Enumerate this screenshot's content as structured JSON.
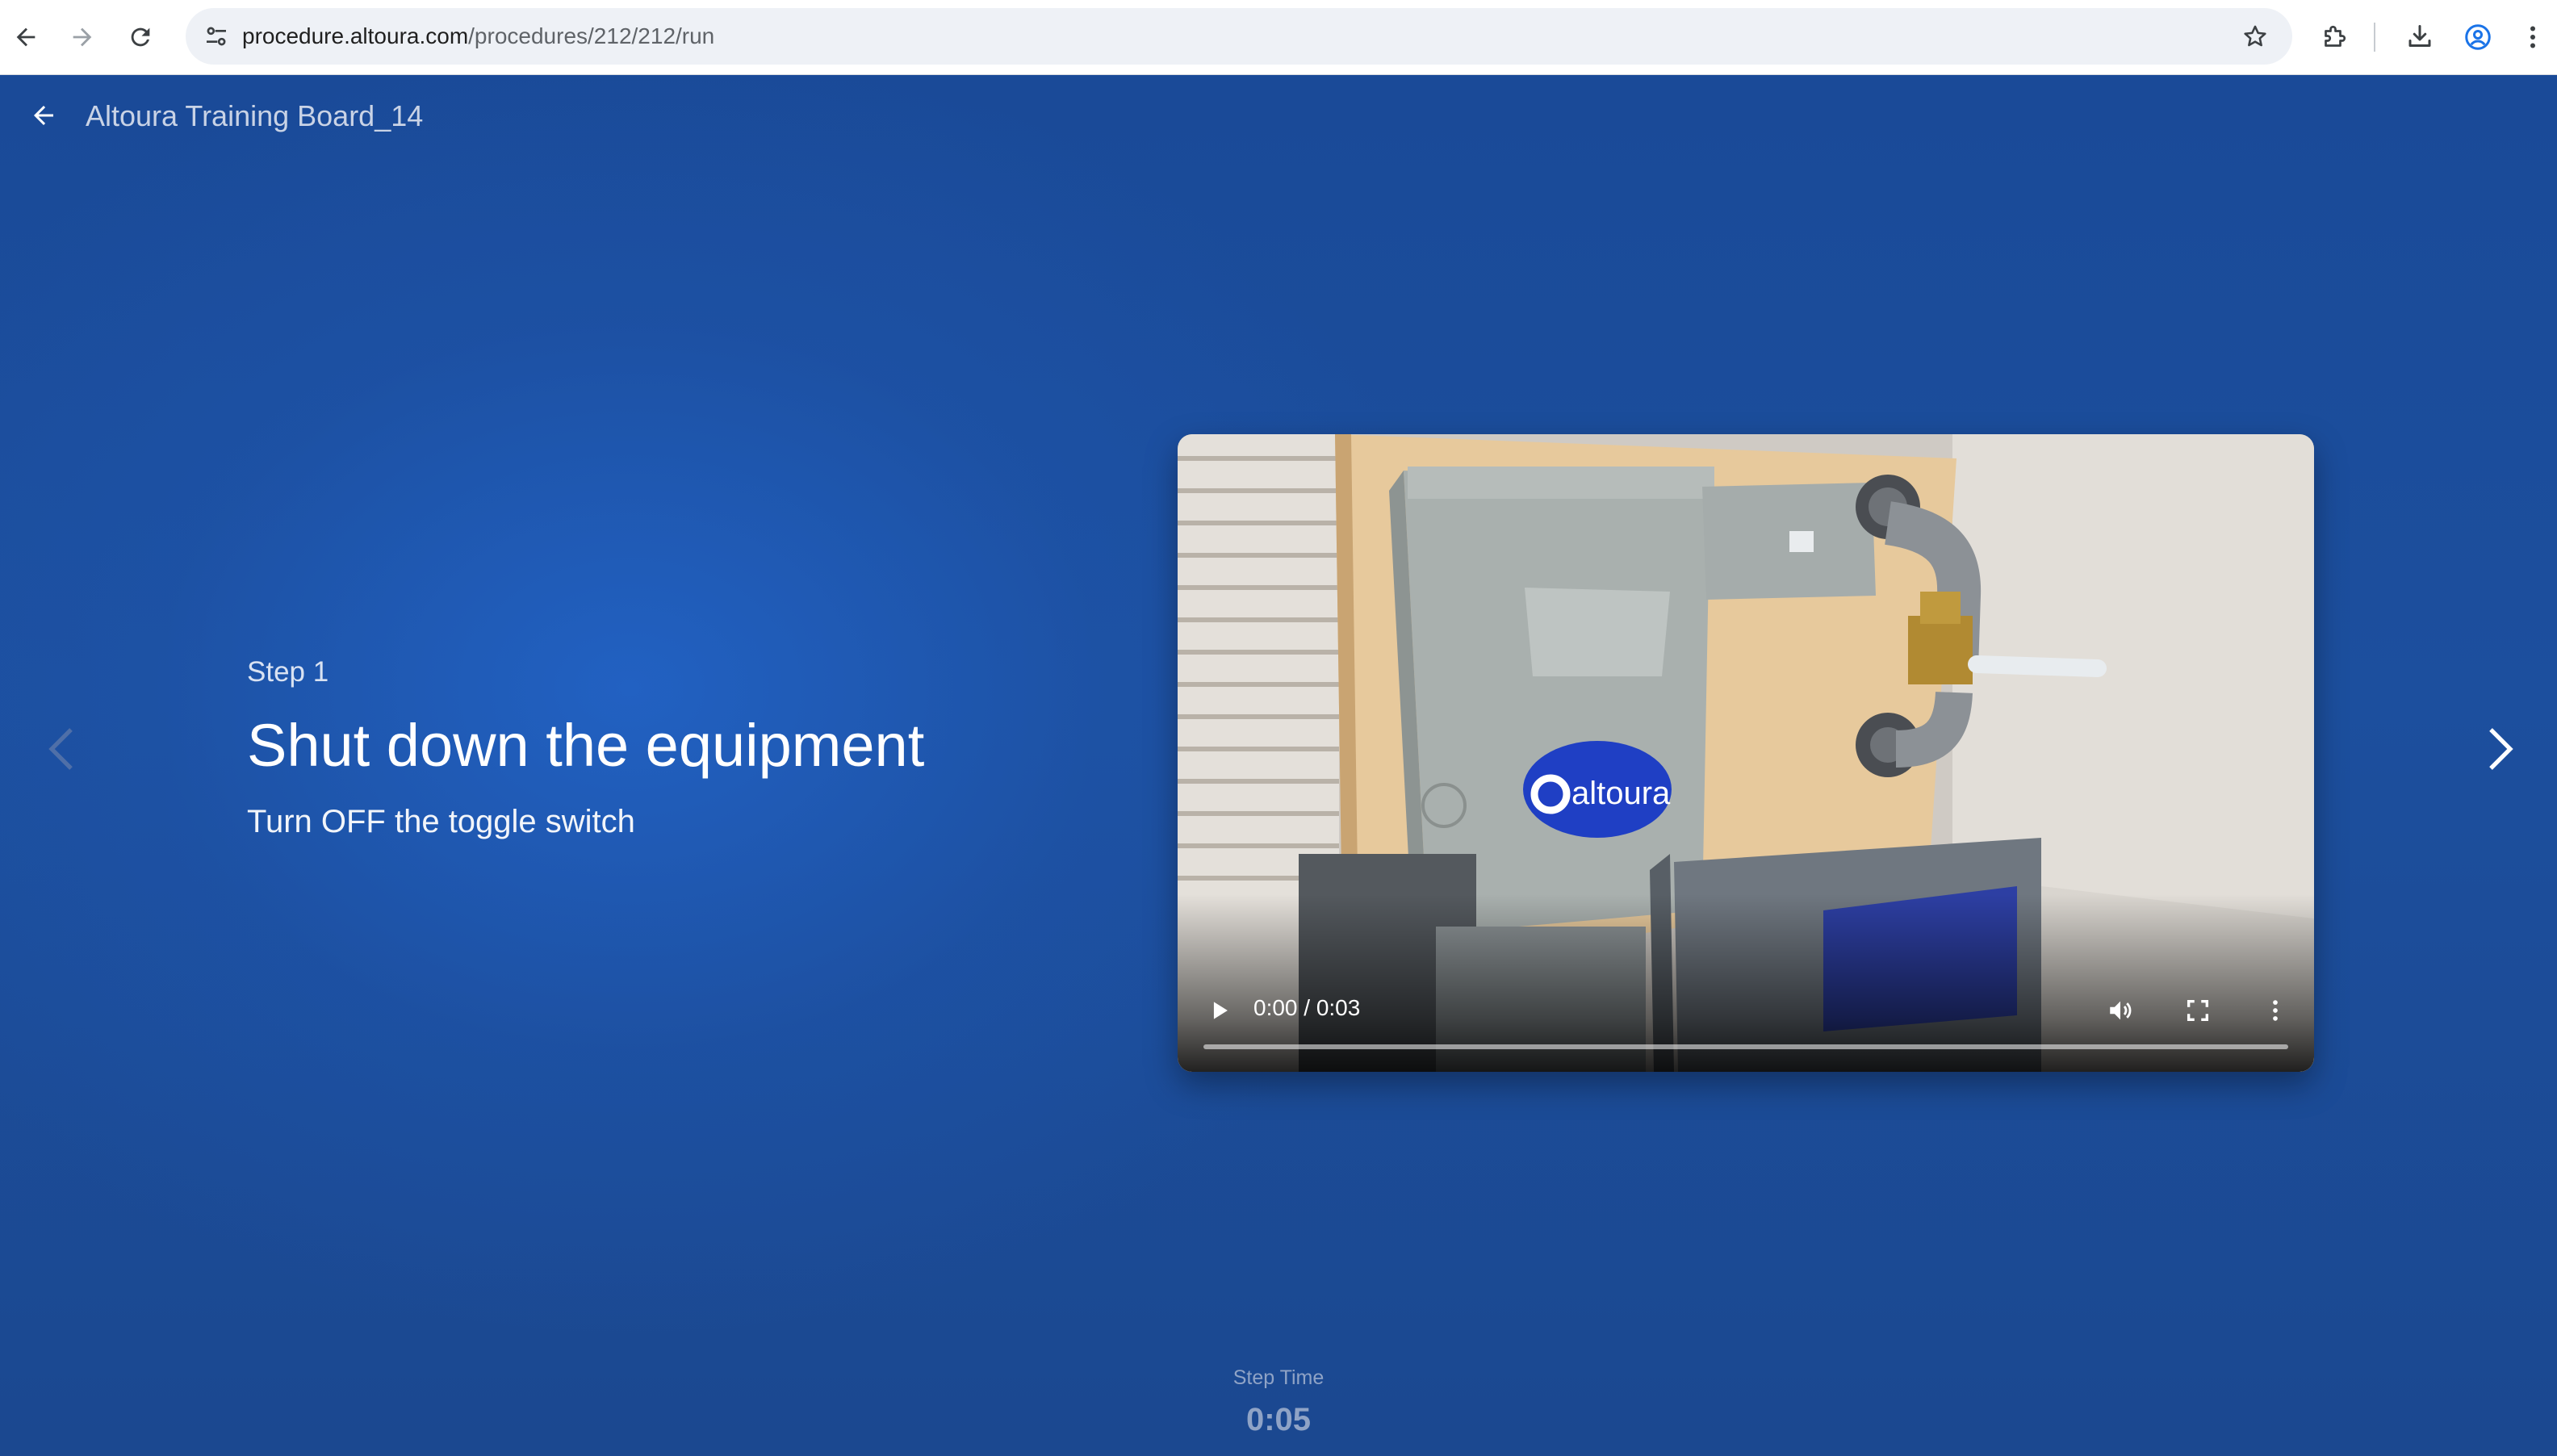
{
  "browser": {
    "url_host": "procedure.altoura.com",
    "url_path": "/procedures/212/212/run",
    "icons": {
      "back": "arrow-left-icon",
      "forward": "arrow-right-icon",
      "reload": "reload-icon",
      "site_info": "tune-icon",
      "bookmark": "star-icon",
      "extensions": "puzzle-icon",
      "downloads": "download-icon",
      "profile": "account-circle-icon",
      "menu": "more-vertical-icon"
    }
  },
  "header": {
    "title": "Altoura Training Board_14"
  },
  "step": {
    "label": "Step 1",
    "heading": "Shut down the equipment",
    "description": "Turn OFF the toggle switch"
  },
  "video": {
    "current_time": "0:00",
    "duration": "0:03",
    "time_display": "0:00 / 0:03",
    "progress": 0,
    "logo_text": "altoura"
  },
  "step_time": {
    "label": "Step Time",
    "value": "0:05"
  },
  "colors": {
    "page_bg": "#1b4f9e",
    "heading": "#ffffff",
    "muted": "#8fa3c6",
    "logo_blue": "#1f3fc4"
  }
}
